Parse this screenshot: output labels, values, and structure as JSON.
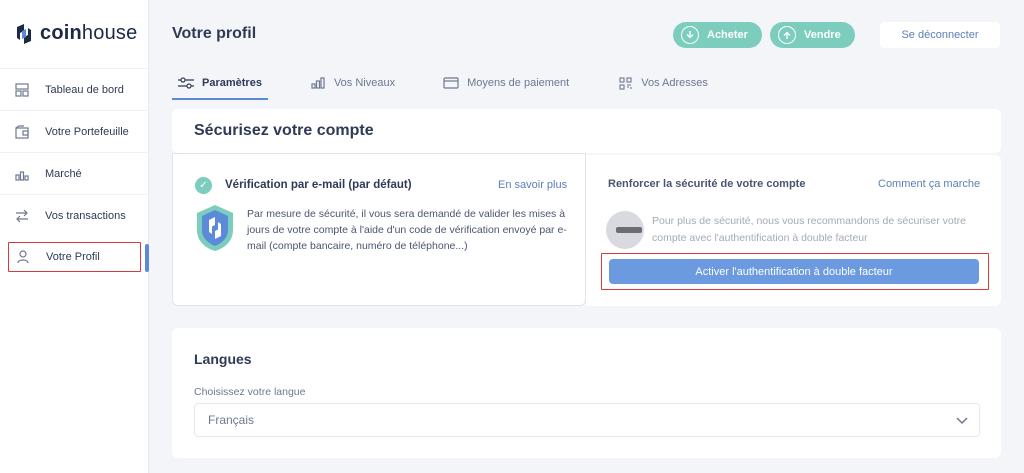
{
  "logo": {
    "brand_bold": "coin",
    "brand_light": "house"
  },
  "sidebar": {
    "items": [
      {
        "label": "Tableau de bord",
        "icon": "dashboard-icon"
      },
      {
        "label": "Votre Portefeuille",
        "icon": "wallet-icon"
      },
      {
        "label": "Marché",
        "icon": "chart-icon"
      },
      {
        "label": "Vos transactions",
        "icon": "transfer-icon"
      },
      {
        "label": "Votre Profil",
        "icon": "user-icon",
        "active": true
      }
    ]
  },
  "header": {
    "title": "Votre profil",
    "buy_label": "Acheter",
    "sell_label": "Vendre",
    "logout_label": "Se déconnecter"
  },
  "tabs": [
    {
      "label": "Paramètres",
      "icon": "sliders-icon",
      "active": true
    },
    {
      "label": "Vos Niveaux",
      "icon": "levels-icon"
    },
    {
      "label": "Moyens de paiement",
      "icon": "card-icon"
    },
    {
      "label": "Vos Adresses",
      "icon": "qr-icon"
    }
  ],
  "security": {
    "title": "Sécurisez votre compte",
    "email": {
      "title": "Vérification par e-mail (par défaut)",
      "link": "En savoir plus",
      "description": "Par mesure de sécurité, il vous sera demandé de valider les mises à jours de votre compte à l'aide d'un code de vérification envoyé par e-mail (compte bancaire, numéro de téléphone...)"
    },
    "twofa": {
      "title": "Renforcer la sécurité de votre compte",
      "link": "Comment ça marche",
      "description": "Pour plus de sécurité, nous vous recommandons de sécuriser votre compte avec l'authentification à double facteur",
      "button": "Activer l'authentification à double facteur"
    }
  },
  "languages": {
    "title": "Langues",
    "label": "Choisissez votre langue",
    "selected": "Français"
  },
  "colors": {
    "accent_green": "#7ccdbd",
    "accent_blue": "#6b9ae0",
    "highlight_red": "#d63a3a"
  }
}
